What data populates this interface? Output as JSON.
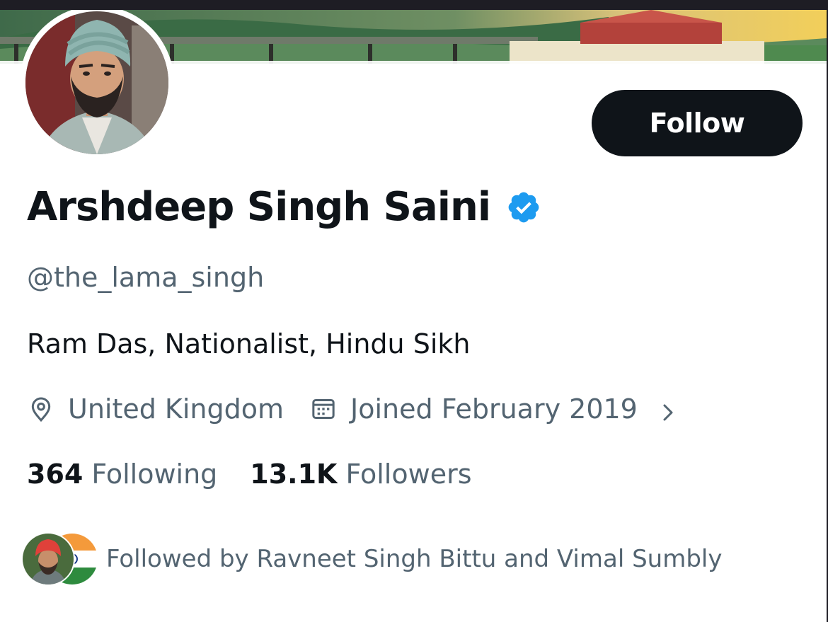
{
  "profile": {
    "display_name": "Arshdeep Singh Saini",
    "handle": "@the_lama_singh",
    "bio": "Ram Das, Nationalist, Hindu Sikh",
    "location": "United Kingdom",
    "joined": "Joined February 2019",
    "follow_label": "Follow"
  },
  "stats": {
    "following_count": "364",
    "following_label": "Following",
    "followers_count": "13.1K",
    "followers_label": "Followers"
  },
  "followed_by": {
    "text": "Followed by Ravneet Singh Bittu and Vimal Sumbly"
  },
  "icons": {
    "verified": "verified-badge-icon",
    "location": "location-pin-icon",
    "calendar": "calendar-icon",
    "chevron": "chevron-right-icon"
  },
  "colors": {
    "verified_blue": "#1d9bf0",
    "text_primary": "#0f1419",
    "text_secondary": "#536471",
    "follow_bg": "#0f1419"
  }
}
